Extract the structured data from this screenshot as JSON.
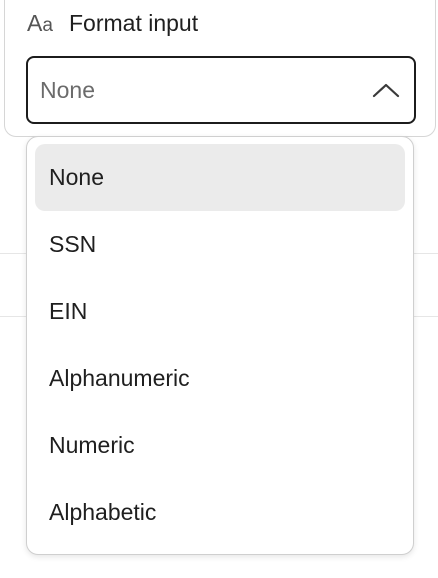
{
  "section": {
    "icon": "text-format-icon",
    "icon_text_big": "A",
    "icon_text_small": "a",
    "title": "Format input"
  },
  "select": {
    "value": "None",
    "chevron_icon": "chevron-up-icon",
    "expanded": true
  },
  "dropdown": {
    "options": [
      {
        "label": "None",
        "selected": true
      },
      {
        "label": "SSN",
        "selected": false
      },
      {
        "label": "EIN",
        "selected": false
      },
      {
        "label": "Alphanumeric",
        "selected": false
      },
      {
        "label": "Numeric",
        "selected": false
      },
      {
        "label": "Alphabetic",
        "selected": false
      }
    ]
  },
  "colors": {
    "selected_bg": "#ebebeb",
    "border": "#cfcfcf",
    "text": "#1f1f1f",
    "muted_text": "#6b6b6b"
  }
}
